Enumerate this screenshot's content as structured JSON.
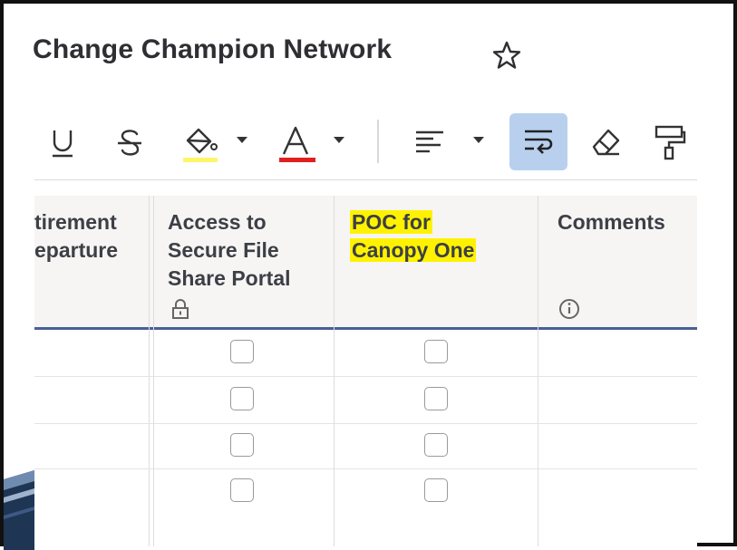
{
  "sheet": {
    "title": "Change Champion Network"
  },
  "toolbar": {
    "buttons": [
      "underline",
      "strikethrough",
      "fill-color",
      "text-color",
      "align",
      "wrap-text",
      "clear-formatting",
      "format-painter"
    ],
    "fill_color_accent": "#fff56b",
    "text_color_accent": "#e02020",
    "active_button": "wrap-text",
    "active_color": "#b8d0ee"
  },
  "grid": {
    "columns": [
      {
        "line1": "tirement",
        "line2": "eparture"
      },
      {
        "line1": "Access to",
        "line2": "Secure File",
        "line3": "Share Portal",
        "locked": true
      },
      {
        "line1": "POC for",
        "line2": "Canopy One",
        "highlight": "#fff200"
      },
      {
        "line1": "Comments",
        "info": true
      }
    ],
    "rows": [
      {
        "access_checked": false,
        "poc_checked": false
      },
      {
        "access_checked": false,
        "poc_checked": false
      },
      {
        "access_checked": false,
        "poc_checked": false
      },
      {
        "access_checked": false,
        "poc_checked": false
      }
    ],
    "header_underline_color": "#4a5f95"
  }
}
